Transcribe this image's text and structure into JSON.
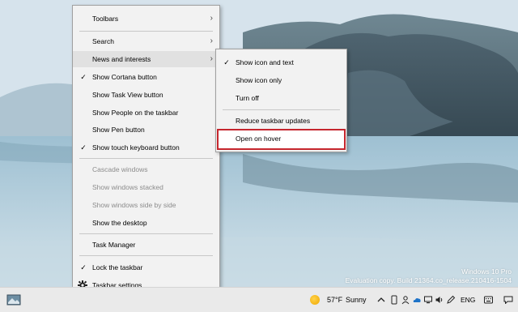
{
  "main_menu": {
    "items": [
      {
        "label": "Toolbars",
        "arrow": true
      },
      {
        "label": "Search",
        "arrow": true
      },
      {
        "label": "News and interests",
        "arrow": true
      },
      {
        "label": "Show Cortana button",
        "checked": true
      },
      {
        "label": "Show Task View button"
      },
      {
        "label": "Show People on the taskbar"
      },
      {
        "label": "Show Pen button"
      },
      {
        "label": "Show touch keyboard button",
        "checked": true
      },
      {
        "label": "Cascade windows",
        "disabled": true
      },
      {
        "label": "Show windows stacked",
        "disabled": true
      },
      {
        "label": "Show windows side by side",
        "disabled": true
      },
      {
        "label": "Show the desktop"
      },
      {
        "label": "Task Manager"
      },
      {
        "label": "Lock the taskbar",
        "checked": true
      },
      {
        "label": "Taskbar settings",
        "icon": "gear-icon"
      }
    ]
  },
  "sub_menu": {
    "items": [
      {
        "label": "Show icon and text",
        "checked": true
      },
      {
        "label": "Show icon only"
      },
      {
        "label": "Turn off"
      },
      {
        "label": "Reduce taskbar updates"
      },
      {
        "label": "Open on hover",
        "highlighted": true
      }
    ]
  },
  "taskbar": {
    "weather_icon": "sun-icon",
    "temperature": "57°F",
    "condition": "Sunny",
    "language": "ENG"
  },
  "watermark": {
    "line1": "Windows 10 Pro",
    "line2": "Evaluation copy. Build 21364.co_release.210416-1504"
  },
  "colors": {
    "highlight_border": "#c6262e",
    "menu_bg": "#f2f2f2",
    "taskbar_bg": "#eaeaea"
  }
}
